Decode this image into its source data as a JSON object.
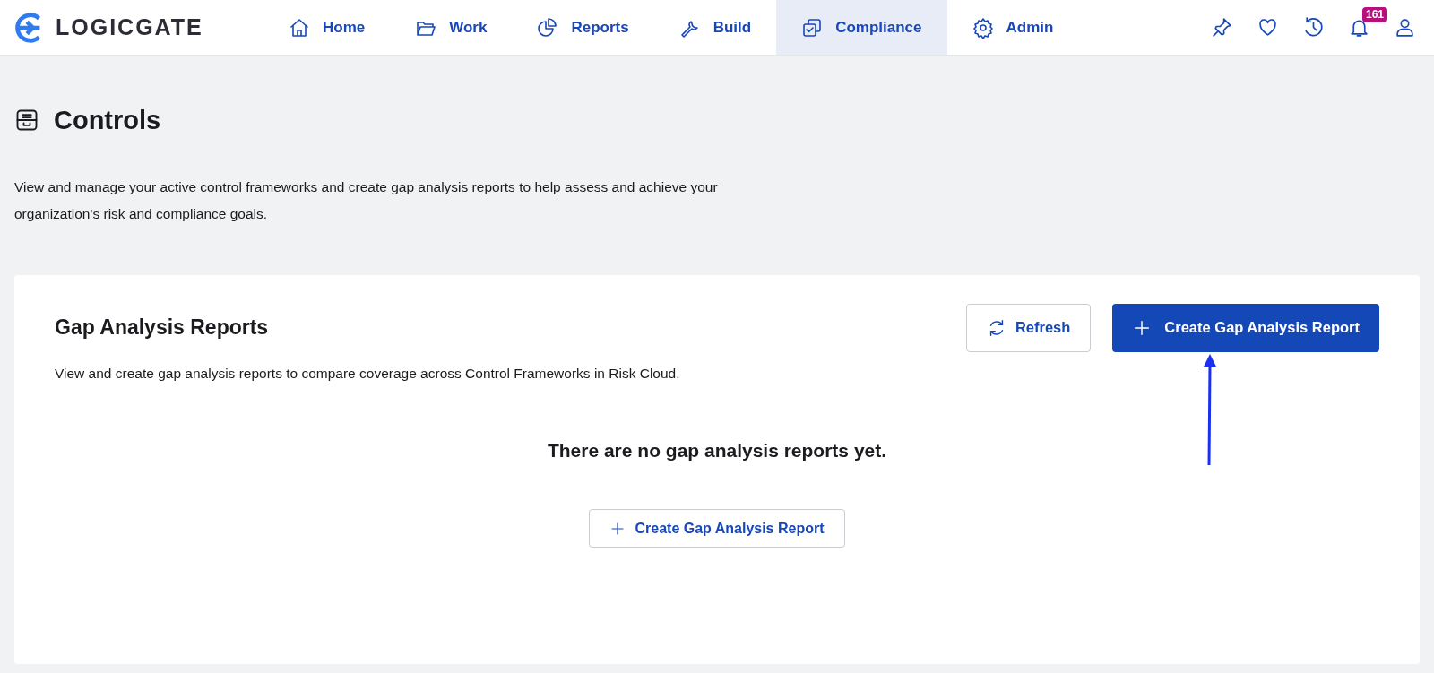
{
  "brand": {
    "name": "LOGICGATE"
  },
  "nav": [
    {
      "label": "Home",
      "kind": "home",
      "selected": false
    },
    {
      "label": "Work",
      "kind": "folder",
      "selected": false
    },
    {
      "label": "Reports",
      "kind": "pie",
      "selected": false
    },
    {
      "label": "Build",
      "kind": "wrench",
      "selected": false
    },
    {
      "label": "Compliance",
      "kind": "stack",
      "selected": true
    },
    {
      "label": "Admin",
      "kind": "gear",
      "selected": false
    }
  ],
  "utilities": [
    {
      "kind": "pin"
    },
    {
      "kind": "heart"
    },
    {
      "kind": "history"
    },
    {
      "kind": "bell",
      "badge": "161"
    },
    {
      "kind": "user"
    }
  ],
  "page": {
    "title": "Controls",
    "description": "View and manage your active control frameworks and create gap analysis reports to help assess and achieve your organization's risk and compliance goals."
  },
  "panel": {
    "title": "Gap Analysis Reports",
    "description": "View and create gap analysis reports to compare coverage across Control Frameworks in Risk Cloud.",
    "buttons": [
      {
        "label": "Refresh",
        "kind": "refresh"
      },
      {
        "label": "Create Gap Analysis Report",
        "kind": "create"
      }
    ],
    "empty_message": "There are no gap analysis reports yet.",
    "empty_button": "Create Gap Analysis Report"
  }
}
